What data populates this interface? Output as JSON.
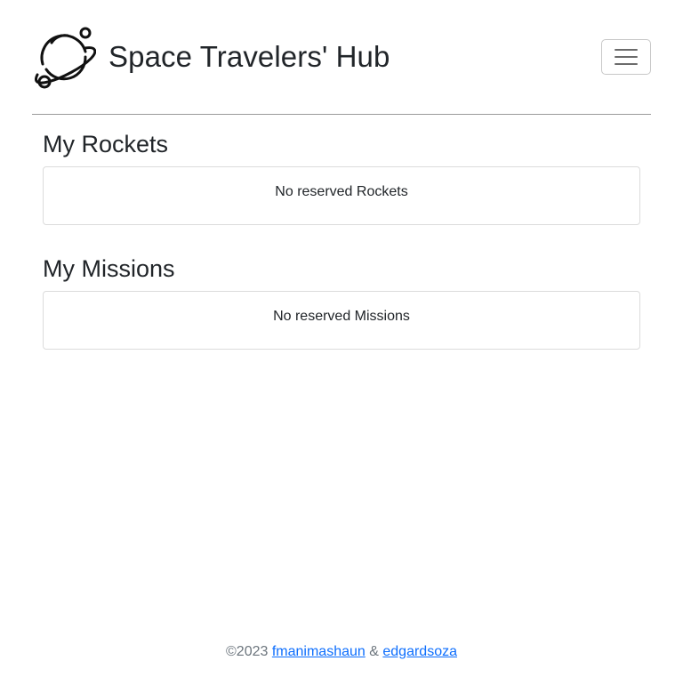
{
  "header": {
    "title": "Space Travelers' Hub",
    "logo_icon": "planet-icon",
    "menu_icon": "hamburger-menu-icon"
  },
  "rockets": {
    "title": "My Rockets",
    "empty_text": "No reserved Rockets"
  },
  "missions": {
    "title": "My Missions",
    "empty_text": "No reserved Missions"
  },
  "footer": {
    "copyright": "©2023",
    "author1": "fmanimashaun",
    "separator": "&",
    "author2": "edgardsoza"
  },
  "colors": {
    "link": "#0d6efd",
    "muted": "#6c757d",
    "text": "#212529"
  }
}
